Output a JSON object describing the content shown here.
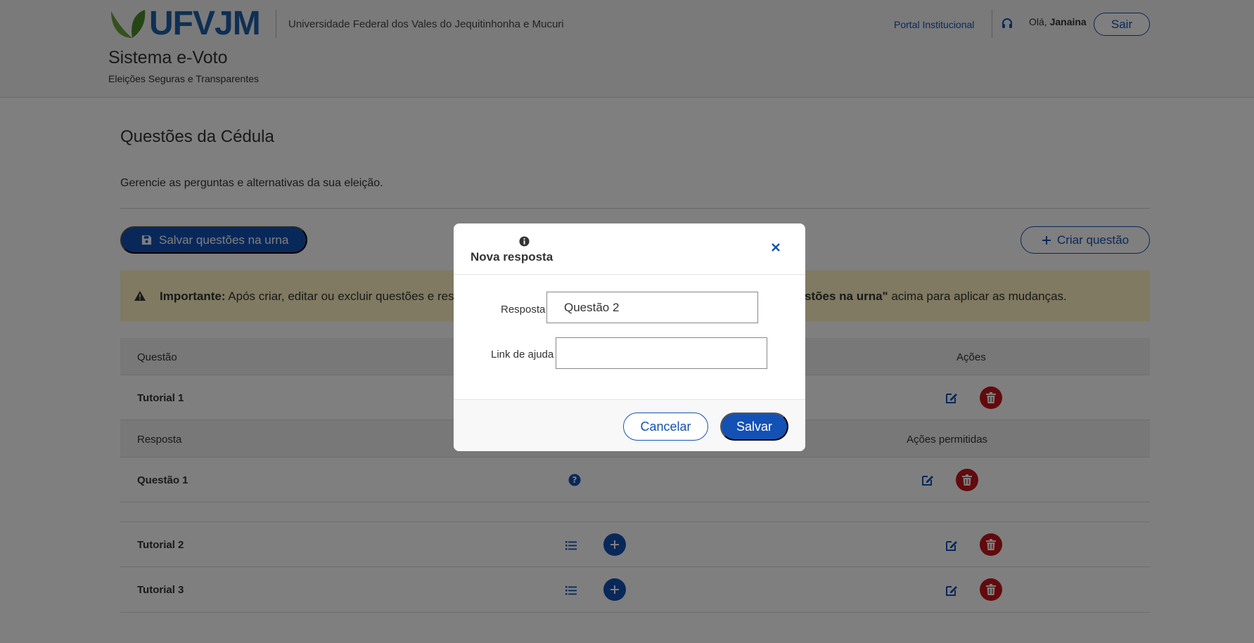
{
  "header": {
    "logo_text": "UFVJM",
    "university": "Universidade Federal dos Vales do Jequitinhonha e Mucuri",
    "system_title": "Sistema e-Voto",
    "system_subtitle": "Eleições Seguras e Transparentes",
    "portal_link": "Portal Institucional",
    "greeting": "Olá,",
    "user_name": "Janaina",
    "logout_label": "Sair"
  },
  "page": {
    "title": "Questões da Cédula",
    "description": "Gerencie as perguntas e alternativas da sua eleição.",
    "save_urn_label": "Salvar questões na urna",
    "create_question_label": "Criar questão"
  },
  "alert": {
    "strong": "Importante:",
    "text_start": "Após criar, editar ou excluir questões e res",
    "text_bold_end": "stões na urna\"",
    "text_end": "acima para aplicar as mudanças."
  },
  "table": {
    "header": {
      "question": "Questão",
      "actions": "Ações"
    },
    "sub_header": {
      "answer": "Resposta",
      "allowed_actions": "Ações permitidas"
    },
    "rows": [
      {
        "label": "Tutorial 1"
      },
      {
        "label": "Questão 1"
      },
      {
        "label": "Tutorial 2"
      },
      {
        "label": "Tutorial 3"
      }
    ]
  },
  "modal": {
    "title": "Nova resposta",
    "answer_label": "Resposta",
    "answer_value": "Questão 2",
    "help_link_label": "Link de ajuda",
    "help_link_value": "",
    "cancel_label": "Cancelar",
    "confirm_label": "Salvar"
  },
  "colors": {
    "primary": "#1351b4",
    "danger": "#c4141b",
    "alert_bg": "#fff5c2",
    "logo_blue": "#1f5fa8",
    "logo_green": "#6aa33a"
  },
  "icons": {
    "save": "save-icon",
    "plus": "plus-icon",
    "warning": "warning-icon",
    "edit": "edit-icon",
    "trash": "trash-icon",
    "list": "list-icon",
    "help": "question-circle-icon",
    "info": "info-icon",
    "close": "close-icon",
    "headset": "headset-icon"
  }
}
